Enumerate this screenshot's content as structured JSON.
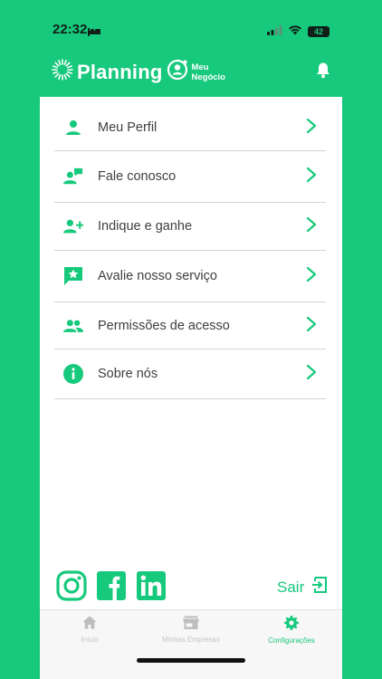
{
  "status_bar": {
    "time": "22:32",
    "battery": "42"
  },
  "header": {
    "brand": "Planning",
    "sub_line1": "Meu",
    "sub_line2": "Negócio",
    "notification_icon": "bell-icon"
  },
  "menu": {
    "items": [
      {
        "label": "Meu Perfil",
        "icon": "person-icon"
      },
      {
        "label": "Fale conosco",
        "icon": "person-chat-icon"
      },
      {
        "label": "Indique e ganhe",
        "icon": "person-add-icon"
      },
      {
        "label": "Avalie nosso serviço",
        "icon": "star-chat-icon"
      },
      {
        "label": "Permissões de acesso",
        "icon": "group-icon"
      },
      {
        "label": "Sobre nós",
        "icon": "info-icon"
      }
    ]
  },
  "social": {
    "instagram": "instagram-icon",
    "facebook": "facebook-icon",
    "linkedin": "linkedin-icon"
  },
  "logout": {
    "label": "Sair"
  },
  "bottom_nav": {
    "items": [
      {
        "label": "Início",
        "icon": "home-icon",
        "active": false
      },
      {
        "label": "Minhas Empresas",
        "icon": "store-icon",
        "active": false
      },
      {
        "label": "Configurações",
        "icon": "gear-icon",
        "active": true
      }
    ]
  },
  "colors": {
    "accent": "#17c97c",
    "card": "#ffffff",
    "text": "#3f3f3f",
    "divider": "#d3d3d3",
    "inactive_nav": "#c4c4c4"
  }
}
